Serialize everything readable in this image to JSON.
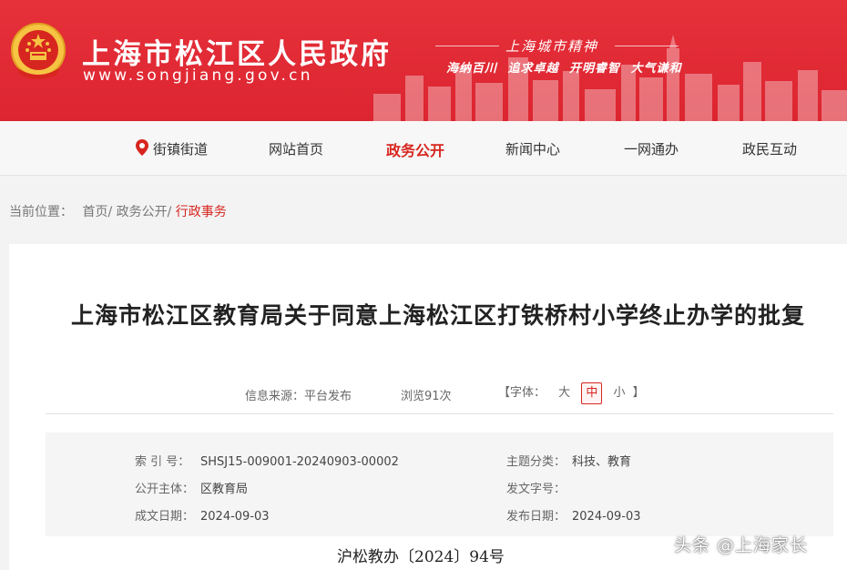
{
  "header": {
    "site_title": "上海市松江区人民政府",
    "site_url": "www.songjiang.gov.cn",
    "spirit_title": "上海城市精神",
    "spirit_words": "海纳百川 追求卓越 开明睿智 大气谦和",
    "brand_color": "#e02b35"
  },
  "nav": {
    "location_label": "街镇街道",
    "items": [
      "网站首页",
      "政务公开",
      "新闻中心",
      "一网通办",
      "政民互动"
    ],
    "active": "政务公开"
  },
  "breadcrumb": {
    "prefix": "当前位置：",
    "items": [
      "首页/",
      "政务公开/",
      "行政事务"
    ]
  },
  "article": {
    "title": "上海市松江区教育局关于同意上海松江区打铁桥村小学终止办学的批复",
    "source": "信息来源：平台发布",
    "views": "浏览91次",
    "font_label": "【字体：",
    "font_large": "大",
    "font_medium": "中",
    "font_small": "小",
    "font_close": "】",
    "info": {
      "index_label": "索 引 号：",
      "index_value": "SHSJ15-009001-20240903-00002",
      "subject_label": "主题分类：",
      "subject_value": "科技、教育",
      "publisher_label": "公开主体：",
      "publisher_value": "区教育局",
      "docnum_label": "发文字号：",
      "docnum_value": "",
      "created_label": "成文日期：",
      "created_value": "2024-09-03",
      "published_label": "发布日期：",
      "published_value": "2024-09-03"
    },
    "doc_number": "沪松教办〔2024〕94号"
  },
  "watermark": "头条 @上海家长"
}
